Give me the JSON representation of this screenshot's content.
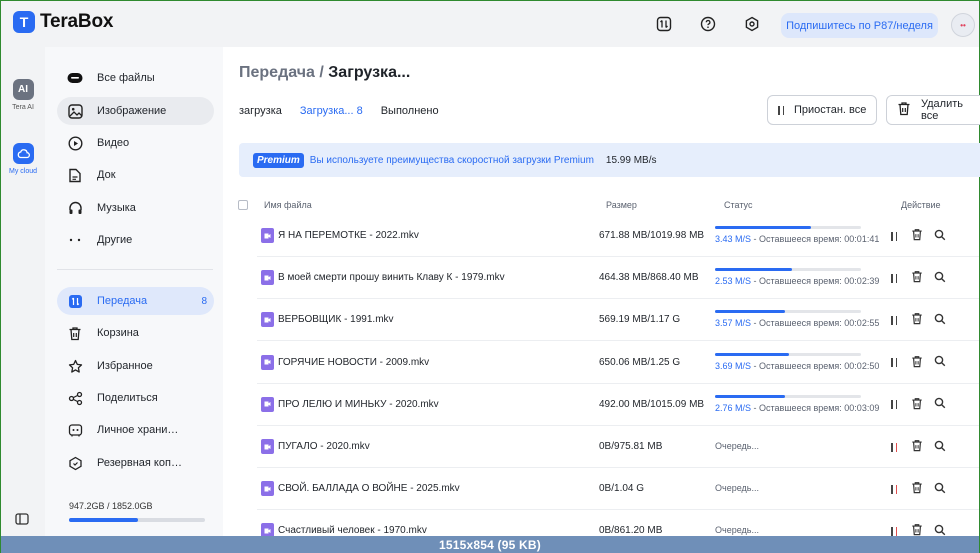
{
  "app": {
    "logo_text": "TeraBox",
    "subscribe_label": "Подпишитесь по Р87/неделя",
    "avatar_text": "••"
  },
  "rail": {
    "items": [
      {
        "badge": "AI",
        "label": "Tera AI"
      },
      {
        "label": "My cloud"
      }
    ]
  },
  "sidebar": {
    "items": [
      {
        "label": "Все файлы",
        "icon": "all-files-icon"
      },
      {
        "label": "Изображение",
        "icon": "image-icon"
      },
      {
        "label": "Видео",
        "icon": "video-icon"
      },
      {
        "label": "Док",
        "icon": "doc-icon"
      },
      {
        "label": "Музыка",
        "icon": "music-icon"
      },
      {
        "label": "Другие",
        "icon": "other-icon"
      }
    ],
    "items2": [
      {
        "label": "Передача",
        "count": "8",
        "icon": "transfer-icon"
      },
      {
        "label": "Корзина",
        "icon": "trash-icon"
      },
      {
        "label": "Избранное",
        "icon": "star-icon"
      },
      {
        "label": "Поделиться",
        "icon": "share-icon"
      },
      {
        "label": "Личное храни…",
        "icon": "vault-icon"
      },
      {
        "label": "Резервная коп…",
        "icon": "backup-icon"
      }
    ],
    "storage_text": "947.2GB / 1852.0GB",
    "storage_fraction": 0.511
  },
  "main": {
    "title_crumb": "Передача",
    "title_sep": " / ",
    "title_current": "Загрузка...",
    "tabs": [
      "загрузка",
      "Загрузка... 8",
      "Выполнено"
    ],
    "pause_all_label": "Приостан. все",
    "delete_all_label": "Удалить все",
    "banner": {
      "tag": "Premium",
      "text": "Вы используете преимущества скоростной загрузки Premium",
      "speed": "15.99 MB/s"
    },
    "columns": {
      "name": "Имя файла",
      "size": "Размер",
      "status": "Статус",
      "action": "Действие"
    },
    "rows": [
      {
        "name": "Я НА ПЕРЕМОТКЕ - 2022.mkv",
        "size": "671.88 MB/1019.98 MB",
        "progress": 0.66,
        "speed": "3.43 M/S",
        "remaining": " - Оставшееся время: 00:01:41"
      },
      {
        "name": "В моей смерти прошу винить Клаву К - 1979.mkv",
        "size": "464.38 MB/868.40 MB",
        "progress": 0.53,
        "speed": "2.53 M/S",
        "remaining": " - Оставшееся время: 00:02:39"
      },
      {
        "name": "ВЕРБОВЩИК - 1991.mkv",
        "size": "569.19 MB/1.17 G",
        "progress": 0.48,
        "speed": "3.57 M/S",
        "remaining": " - Оставшееся время: 00:02:55"
      },
      {
        "name": "ГОРЯЧИЕ НОВОСТИ - 2009.mkv",
        "size": "650.06 MB/1.25 G",
        "progress": 0.51,
        "speed": "3.69 M/S",
        "remaining": " - Оставшееся время: 00:02:50"
      },
      {
        "name": "ПРО ЛЕЛЮ И МИНЬКУ - 2020.mkv",
        "size": "492.00 MB/1015.09 MB",
        "progress": 0.48,
        "speed": "2.76 M/S",
        "remaining": " - Оставшееся время: 00:03:09"
      },
      {
        "name": "ПУГАЛО - 2020.mkv",
        "size": "0B/975.81 MB",
        "queued": "Очередь..."
      },
      {
        "name": "СВОЙ. БАЛЛАДА О ВОЙНЕ - 2025.mkv",
        "size": "0B/1.04 G",
        "queued": "Очередь..."
      },
      {
        "name": "Счастливый человек - 1970.mkv",
        "size": "0B/861.20 MB",
        "queued": "Очередь..."
      }
    ]
  },
  "watermark": "1515x854 (95 KB)"
}
